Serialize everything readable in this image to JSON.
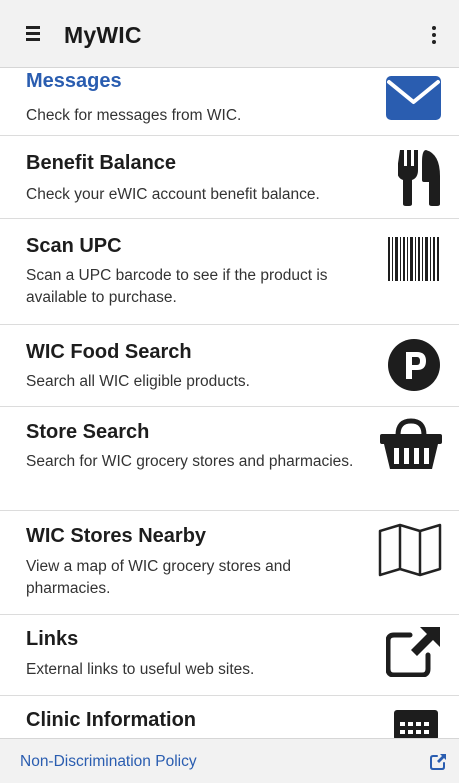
{
  "app": {
    "title": "MyWIC"
  },
  "colors": {
    "accent": "#2a5db0",
    "text": "#1d1d1d",
    "icon": "#222222"
  },
  "items": [
    {
      "title": "Messages",
      "description": "Check for messages from WIC.",
      "icon": "envelope-icon"
    },
    {
      "title": "Benefit Balance",
      "description": "Check your eWIC account benefit balance.",
      "icon": "fork-knife-icon"
    },
    {
      "title": "Scan UPC",
      "description": "Scan a UPC barcode to see if the product is available to purchase.",
      "icon": "barcode-icon"
    },
    {
      "title": "WIC Food Search",
      "description": "Search all WIC eligible products.",
      "icon": "product-p-icon"
    },
    {
      "title": "Store Search",
      "description": "Search for WIC grocery stores and pharmacies.",
      "icon": "basket-icon"
    },
    {
      "title": "WIC Stores Nearby",
      "description": "View a map of WIC grocery stores and pharmacies.",
      "icon": "map-icon"
    },
    {
      "title": "Links",
      "description": "External links to useful web sites.",
      "icon": "external-link-icon"
    },
    {
      "title": "Clinic Information",
      "description": "",
      "icon": "keypad-icon"
    }
  ],
  "footer": {
    "link_label": "Non-Discrimination Policy",
    "link_icon": "external-link-icon"
  }
}
